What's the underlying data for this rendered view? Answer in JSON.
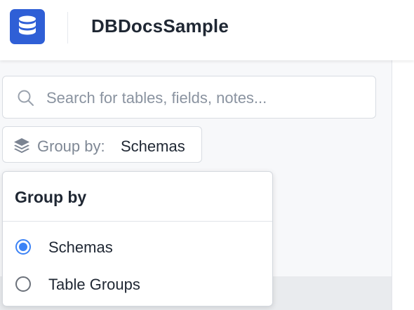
{
  "app": {
    "project_name": "DBDocsSample",
    "logo_icon": "database-icon",
    "brand_color": "#2f5fd6"
  },
  "search": {
    "placeholder": "Search for tables, fields, notes...",
    "icon": "search-icon"
  },
  "group_by_button": {
    "label": "Group by:",
    "value": "Schemas",
    "icon": "layers-icon"
  },
  "group_by_menu": {
    "title": "Group by",
    "options": [
      {
        "label": "Schemas",
        "selected": true
      },
      {
        "label": "Table Groups",
        "selected": false
      }
    ],
    "accent_color": "#3b82f6"
  }
}
